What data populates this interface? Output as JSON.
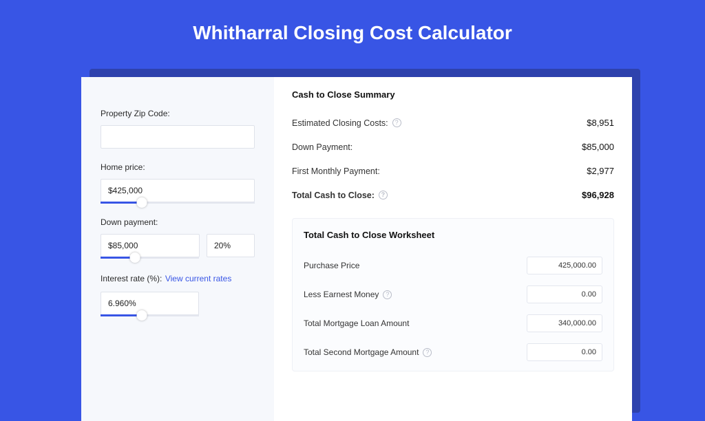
{
  "page_title": "Whitharral Closing Cost Calculator",
  "left": {
    "zip_label": "Property Zip Code:",
    "zip_value": "",
    "price_label": "Home price:",
    "price_value": "$425,000",
    "price_slider_pct": 27,
    "down_label": "Down payment:",
    "down_value": "$85,000",
    "down_pct_value": "20%",
    "down_slider_pct": 35,
    "rate_label_prefix": "Interest rate (%):",
    "rate_link": "View current rates",
    "rate_value": "6.960%",
    "rate_slider_pct": 42
  },
  "summary": {
    "title": "Cash to Close Summary",
    "rows": [
      {
        "label": "Estimated Closing Costs:",
        "value": "$8,951",
        "help": true,
        "bold": false
      },
      {
        "label": "Down Payment:",
        "value": "$85,000",
        "help": false,
        "bold": false
      },
      {
        "label": "First Monthly Payment:",
        "value": "$2,977",
        "help": false,
        "bold": false
      },
      {
        "label": "Total Cash to Close:",
        "value": "$96,928",
        "help": true,
        "bold": true
      }
    ]
  },
  "worksheet": {
    "title": "Total Cash to Close Worksheet",
    "rows": [
      {
        "label": "Purchase Price",
        "value": "425,000.00",
        "help": false
      },
      {
        "label": "Less Earnest Money",
        "value": "0.00",
        "help": true
      },
      {
        "label": "Total Mortgage Loan Amount",
        "value": "340,000.00",
        "help": false
      },
      {
        "label": "Total Second Mortgage Amount",
        "value": "0.00",
        "help": true
      }
    ]
  }
}
